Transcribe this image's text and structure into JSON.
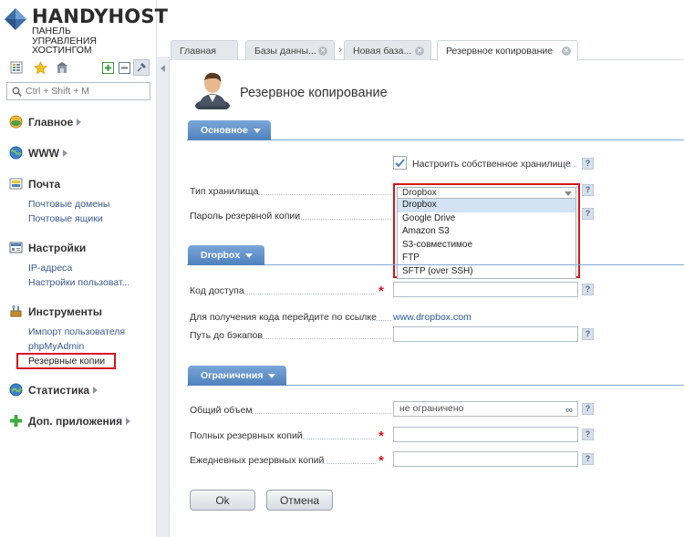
{
  "brand": {
    "name": "HANDYHOST",
    "subtitle_lines": [
      "ПАНЕЛЬ",
      "УПРАВЛЕНИЯ",
      "ХОСТИНГОМ"
    ]
  },
  "search": {
    "placeholder": "Ctrl + Shift + M"
  },
  "nav": {
    "main": {
      "label": "Главное"
    },
    "www": {
      "label": "WWW"
    },
    "mail": {
      "label": "Почта",
      "items": [
        "Почтовые домены",
        "Почтовые ящики"
      ]
    },
    "settings": {
      "label": "Настройки",
      "items": [
        "IP-адреса",
        "Настройки пользоват..."
      ]
    },
    "tools": {
      "label": "Инструменты",
      "items": [
        "Импорт пользователя",
        "phpMyAdmin",
        "Резервные копии"
      ]
    },
    "stats": {
      "label": "Статистика"
    },
    "apps": {
      "label": "Доп. приложения"
    }
  },
  "tabs": [
    {
      "label": "Главная"
    },
    {
      "label": "Базы данны..."
    },
    {
      "label": "Новая база..."
    },
    {
      "label": "Резервное копирование"
    }
  ],
  "page": {
    "title": "Резервное копирование"
  },
  "sections": {
    "basic": "Основное",
    "dropbox": "Dropbox",
    "limits": "Ограничения"
  },
  "form": {
    "own_storage_label": "Настроить собственное хранилище",
    "storage_type_label": "Тип хранилища",
    "storage_type_value": "Dropbox",
    "storage_options": [
      "Dropbox",
      "Google Drive",
      "Amazon S3",
      "S3-совместимое",
      "FTP",
      "SFTP (over SSH)"
    ],
    "backup_password_label": "Пароль резервной копии",
    "access_code_label": "Код доступа",
    "get_code_label": "Для получения кода перейдите по ссылке",
    "get_code_link": "www.dropbox.com",
    "backup_path_label": "Путь до бэкапов",
    "total_volume_label": "Общий объем",
    "total_volume_value": "не ограничено",
    "full_copies_label": "Полных резервных копий",
    "daily_copies_label": "Ежедневных резервных копий",
    "help_symbol": "?",
    "required_symbol": "*"
  },
  "buttons": {
    "ok": "Ok",
    "cancel": "Отмена"
  },
  "colors": {
    "accent": "#4f81bd",
    "highlight": "#d4161c"
  }
}
